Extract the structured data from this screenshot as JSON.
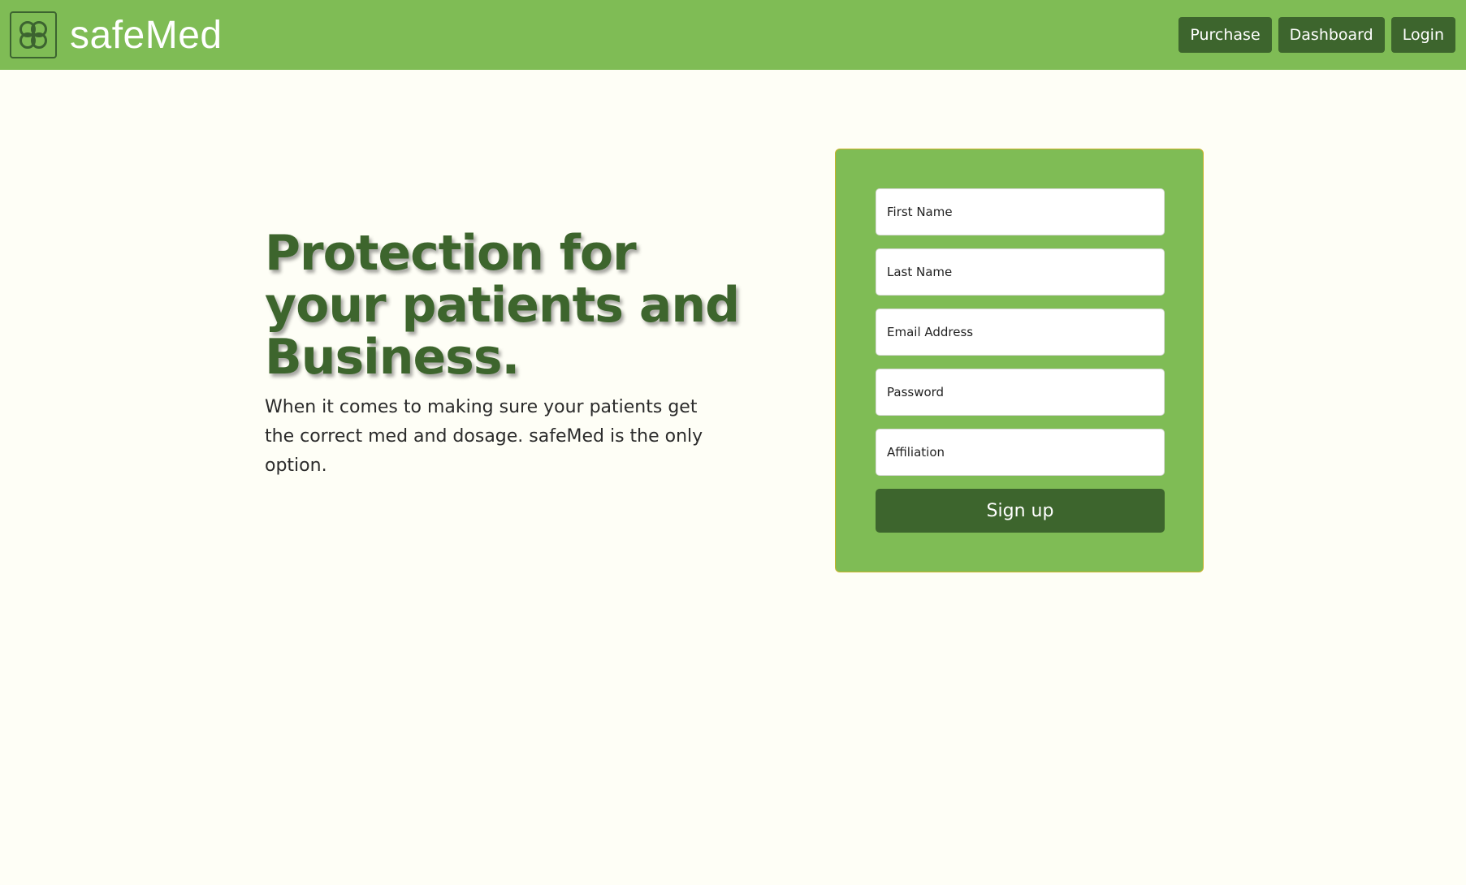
{
  "brand": {
    "name": "safeMed",
    "logo_icon": "four-leaf-clover-icon"
  },
  "nav": {
    "purchase_label": "Purchase",
    "dashboard_label": "Dashboard",
    "login_label": "Login"
  },
  "hero": {
    "title": "Protection for your patients and Business.",
    "subtitle": "When it comes to making sure your patients get the correct med and dosage. safeMed is the only option."
  },
  "signup_form": {
    "first_name_placeholder": "First Name",
    "last_name_placeholder": "Last Name",
    "email_placeholder": "Email Address",
    "password_placeholder": "Password",
    "affiliation_placeholder": "Affiliation",
    "submit_label": "Sign up"
  },
  "colors": {
    "primary_green": "#7fbc55",
    "dark_green": "#3d652d",
    "background": "#fefef6",
    "card_border": "#c9b32a"
  }
}
